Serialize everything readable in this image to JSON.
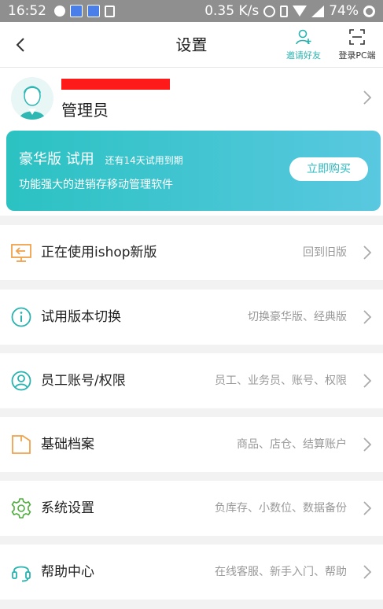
{
  "status_bar": {
    "time": "16:52",
    "speed": "0.35 K/s",
    "battery": "74%"
  },
  "header": {
    "title": "设置",
    "invite_label": "邀请好友",
    "pc_login_label": "登录PC端"
  },
  "profile": {
    "role": "管理员"
  },
  "banner": {
    "edition": "豪华版 试用",
    "trial_note": "还有14天试用到期",
    "tagline": "功能强大的进销存移动管理软件",
    "buy_label": "立即购买"
  },
  "menu": [
    {
      "label": "正在使用ishop新版",
      "sub": "回到旧版",
      "icon": "screen-back-icon"
    },
    {
      "label": "试用版本切换",
      "sub": "切换豪华版、经典版",
      "icon": "info-icon"
    },
    {
      "label": "员工账号/权限",
      "sub": "员工、业务员、账号、权限",
      "icon": "user-circle-icon"
    },
    {
      "label": "基础档案",
      "sub": "商品、店仓、结算账户",
      "icon": "folder-icon"
    },
    {
      "label": "系统设置",
      "sub": "负库存、小数位、数据备份",
      "icon": "gear-icon"
    },
    {
      "label": "帮助中心",
      "sub": "在线客服、新手入门、帮助",
      "icon": "headset-icon"
    }
  ],
  "colors": {
    "accent": "#27b4b0",
    "orange": "#f0a24a",
    "banner_start": "#2bc2c2",
    "banner_end": "#59c8e0"
  }
}
